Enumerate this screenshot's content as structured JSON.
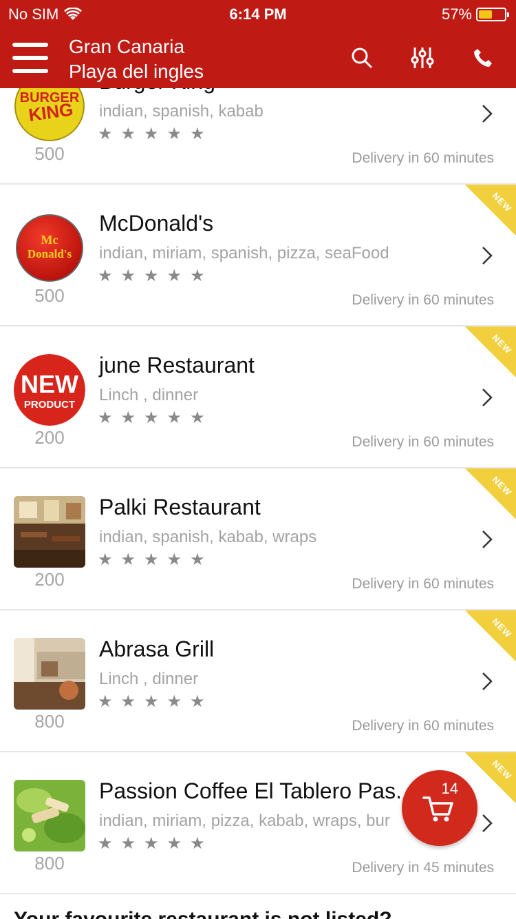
{
  "status_bar": {
    "carrier": "No SIM",
    "time": "6:14 PM",
    "battery_percent": "57%",
    "battery_level": 0.57
  },
  "header": {
    "city": "Gran Canaria",
    "area": "Playa del ingles"
  },
  "restaurants": [
    {
      "name": "Burger King",
      "cuisine": "indian, spanish, kabab",
      "price": "500",
      "delivery": "Delivery in 60 minutes",
      "logo": "burger-king-logo",
      "logo_text_1": "BURGER",
      "logo_text_2": "KING",
      "stars": "★★★★★",
      "is_new": false
    },
    {
      "name": "McDonald's",
      "cuisine": "indian, miriam, spanish, pizza, seaFood",
      "price": "500",
      "delivery": "Delivery in 60 minutes",
      "logo": "mcdonalds-logo",
      "logo_text_1": "Mc",
      "logo_text_2": "Donald's",
      "stars": "★★★★★",
      "is_new": true,
      "badge": "NEW"
    },
    {
      "name": "june Restaurant",
      "cuisine": "Linch , dinner",
      "price": "200",
      "delivery": "Delivery in 60 minutes",
      "logo": "new-product-logo",
      "logo_text_1": "NEW",
      "logo_text_2": "PRODUCT",
      "stars": "★★★★★",
      "is_new": true,
      "badge": "NEW"
    },
    {
      "name": "Palki Restaurant",
      "cuisine": "indian, spanish, kabab, wraps",
      "price": "200",
      "delivery": "Delivery in 60 minutes",
      "logo": "restaurant-interior-photo",
      "stars": "★★★★★",
      "is_new": true,
      "badge": "NEW"
    },
    {
      "name": "Abrasa Grill",
      "cuisine": "Linch , dinner",
      "price": "800",
      "delivery": "Delivery in 60 minutes",
      "logo": "dining-room-photo",
      "stars": "★★★★★",
      "is_new": true,
      "badge": "NEW"
    },
    {
      "name": "Passion Coffee El Tablero Pas...",
      "cuisine": "indian, miriam, pizza, kabab, wraps, bur",
      "price": "800",
      "delivery": "Delivery in 45 minutes",
      "logo": "salad-photo",
      "stars": "★★★★★",
      "is_new": true,
      "badge": "NEW"
    }
  ],
  "cart": {
    "count": "14"
  },
  "footer": {
    "text": "Your favourite restaurant is not listed?"
  },
  "colors": {
    "header": "#bf1a14",
    "ribbon": "#f1cf3d",
    "cart": "#d12a1d",
    "battery": "#f5c518"
  }
}
